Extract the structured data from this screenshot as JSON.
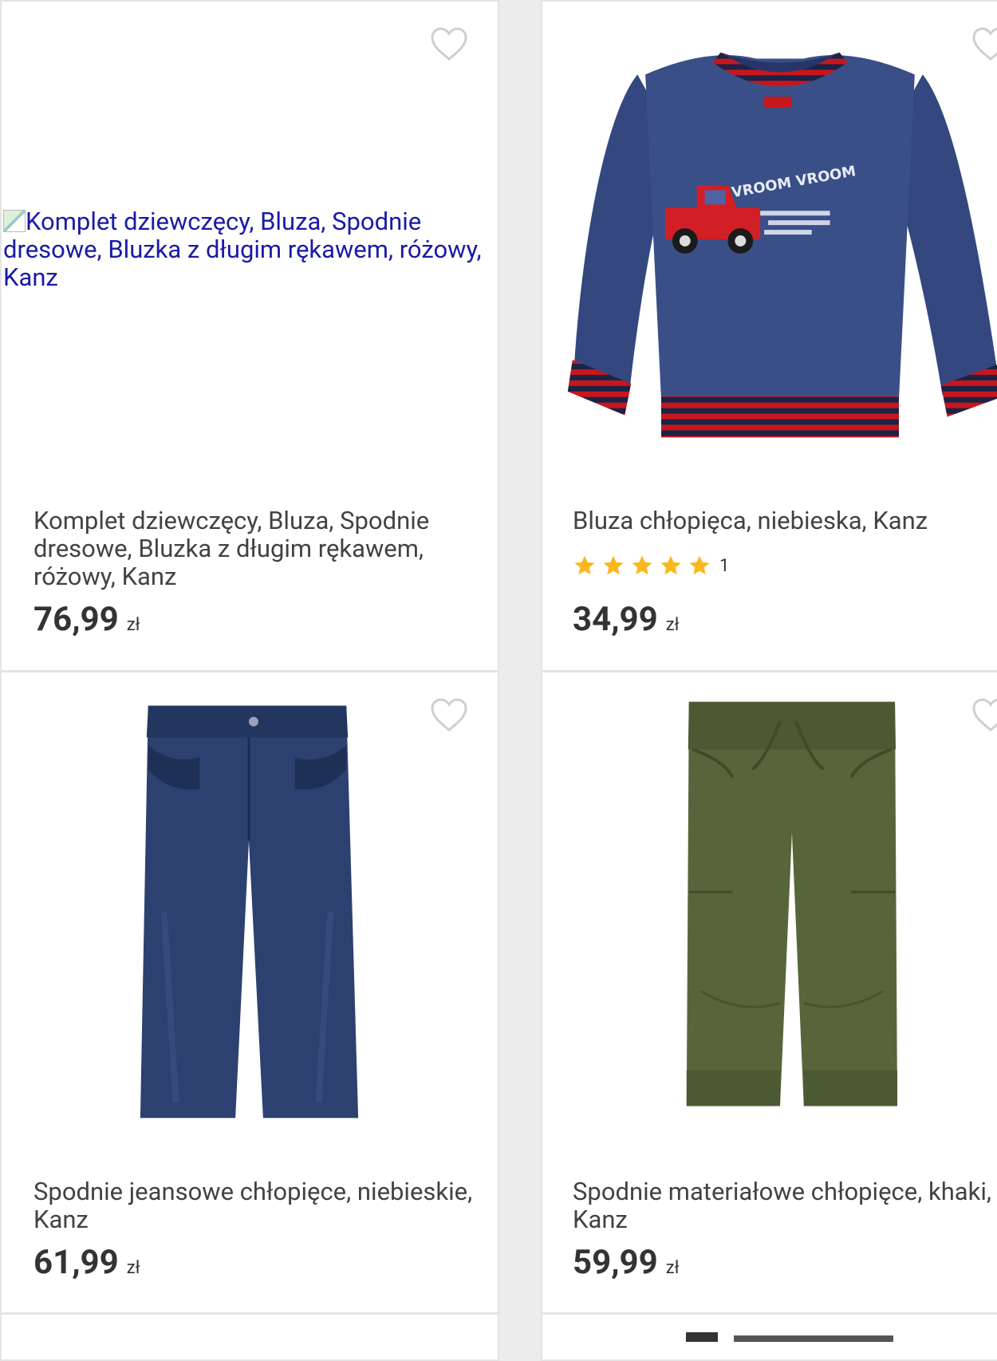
{
  "products": [
    {
      "image_alt": "Komplet dziewczęcy, Bluza, Spodnie dresowe, Bluzka z długim rękawem, różowy, Kanz",
      "title": "Komplet dziewczęcy, Bluza, Spodnie dresowe, Bluzka z długim rękawem, różowy, Kanz",
      "price": "76,99",
      "currency": "zł"
    },
    {
      "title": "Bluza chłopięca, niebieska, Kanz",
      "rating_count": "1",
      "rating_stars": 5,
      "price": "34,99",
      "currency": "zł",
      "print_text": "VROOM VROOM"
    },
    {
      "title": "Spodnie jeansowe chłopięce, niebieskie, Kanz",
      "price": "61,99",
      "currency": "zł"
    },
    {
      "title": "Spodnie materiałowe chłopięce, khaki, Kanz",
      "price": "59,99",
      "currency": "zł"
    }
  ],
  "colors": {
    "star": "#f9b91d",
    "price": "#333333",
    "link": "#1a1aa6"
  }
}
